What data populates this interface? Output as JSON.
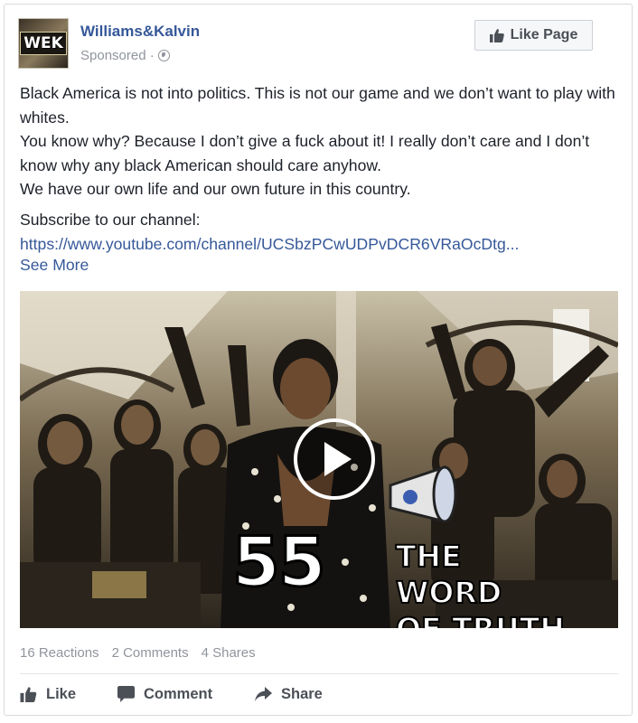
{
  "post": {
    "page_name": "Williams&Kalvin",
    "avatar_text": "WEK",
    "sponsored_label": "Sponsored ·",
    "privacy_icon": "globe-icon",
    "like_page_label": "Like Page",
    "lines": [
      "Black America is not into politics. This is not our game and we don’t want to play with whites.",
      "You know why? Because I don’t give a fuck about it! I really don’t care and I don’t know why any black American should care anyhow.",
      "We have our own life and our own future in this country."
    ],
    "subscribe_text": "Subscribe to our channel:",
    "link_text": "https://www.youtube.com/channel/UCSbzPCwUDPvDCR6VRaOcDtg...",
    "see_more_label": "See More"
  },
  "media": {
    "overlay_number": "55",
    "overlay_title_line1": "THE WORD",
    "overlay_title_line2": "OF TRUTH",
    "play_icon": "play-icon"
  },
  "stats": {
    "reactions": "16 Reactions",
    "comments": "2 Comments",
    "shares": "4 Shares"
  },
  "actions": {
    "like_label": "Like",
    "comment_label": "Comment",
    "share_label": "Share"
  },
  "colors": {
    "link": "#365899",
    "muted": "#90949c",
    "text": "#1d2129",
    "button_text": "#4b4f56"
  }
}
